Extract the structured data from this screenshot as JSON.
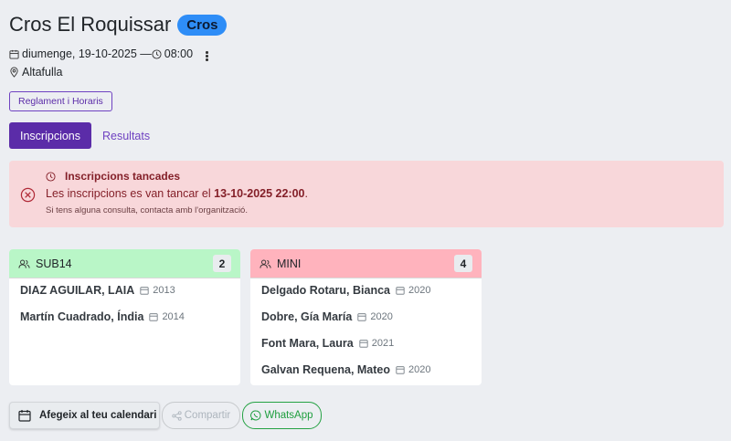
{
  "event": {
    "title": "Cros El Roquissar",
    "badge": "Cros",
    "date_time": "diumenge, 19-10-2025 — ",
    "time": "08:00",
    "location": "Altafulla"
  },
  "buttons": {
    "regulations": "Reglament i Horaris",
    "add_calendar": "Afegeix al teu calendari",
    "share": "Compartir",
    "whatsapp": "WhatsApp"
  },
  "tabs": [
    {
      "label": "Inscripcions",
      "active": true
    },
    {
      "label": "Resultats",
      "active": false
    }
  ],
  "alert": {
    "title": "Inscripcions tancades",
    "message_prefix": "Les inscripcions es van tancar el ",
    "message_date": "13-10-2025 22:00",
    "message_suffix": ".",
    "note": "Si tens alguna consulta, contacta amb l'organització."
  },
  "categories": [
    {
      "name": "SUB14",
      "count": "2",
      "color": "#b9f6c7",
      "participants": [
        {
          "name": "DIAZ AGUILAR, LAIA",
          "year": "2013"
        },
        {
          "name": "Martín Cuadrado, Índia",
          "year": "2014"
        }
      ]
    },
    {
      "name": "MINI",
      "count": "4",
      "color": "#ffb3bd",
      "participants": [
        {
          "name": "Delgado Rotaru, Bianca",
          "year": "2020"
        },
        {
          "name": "Dobre, Gía María",
          "year": "2020"
        },
        {
          "name": "Font Mara, Laura",
          "year": "2021"
        },
        {
          "name": "Galvan Requena, Mateo",
          "year": "2020"
        }
      ]
    }
  ]
}
